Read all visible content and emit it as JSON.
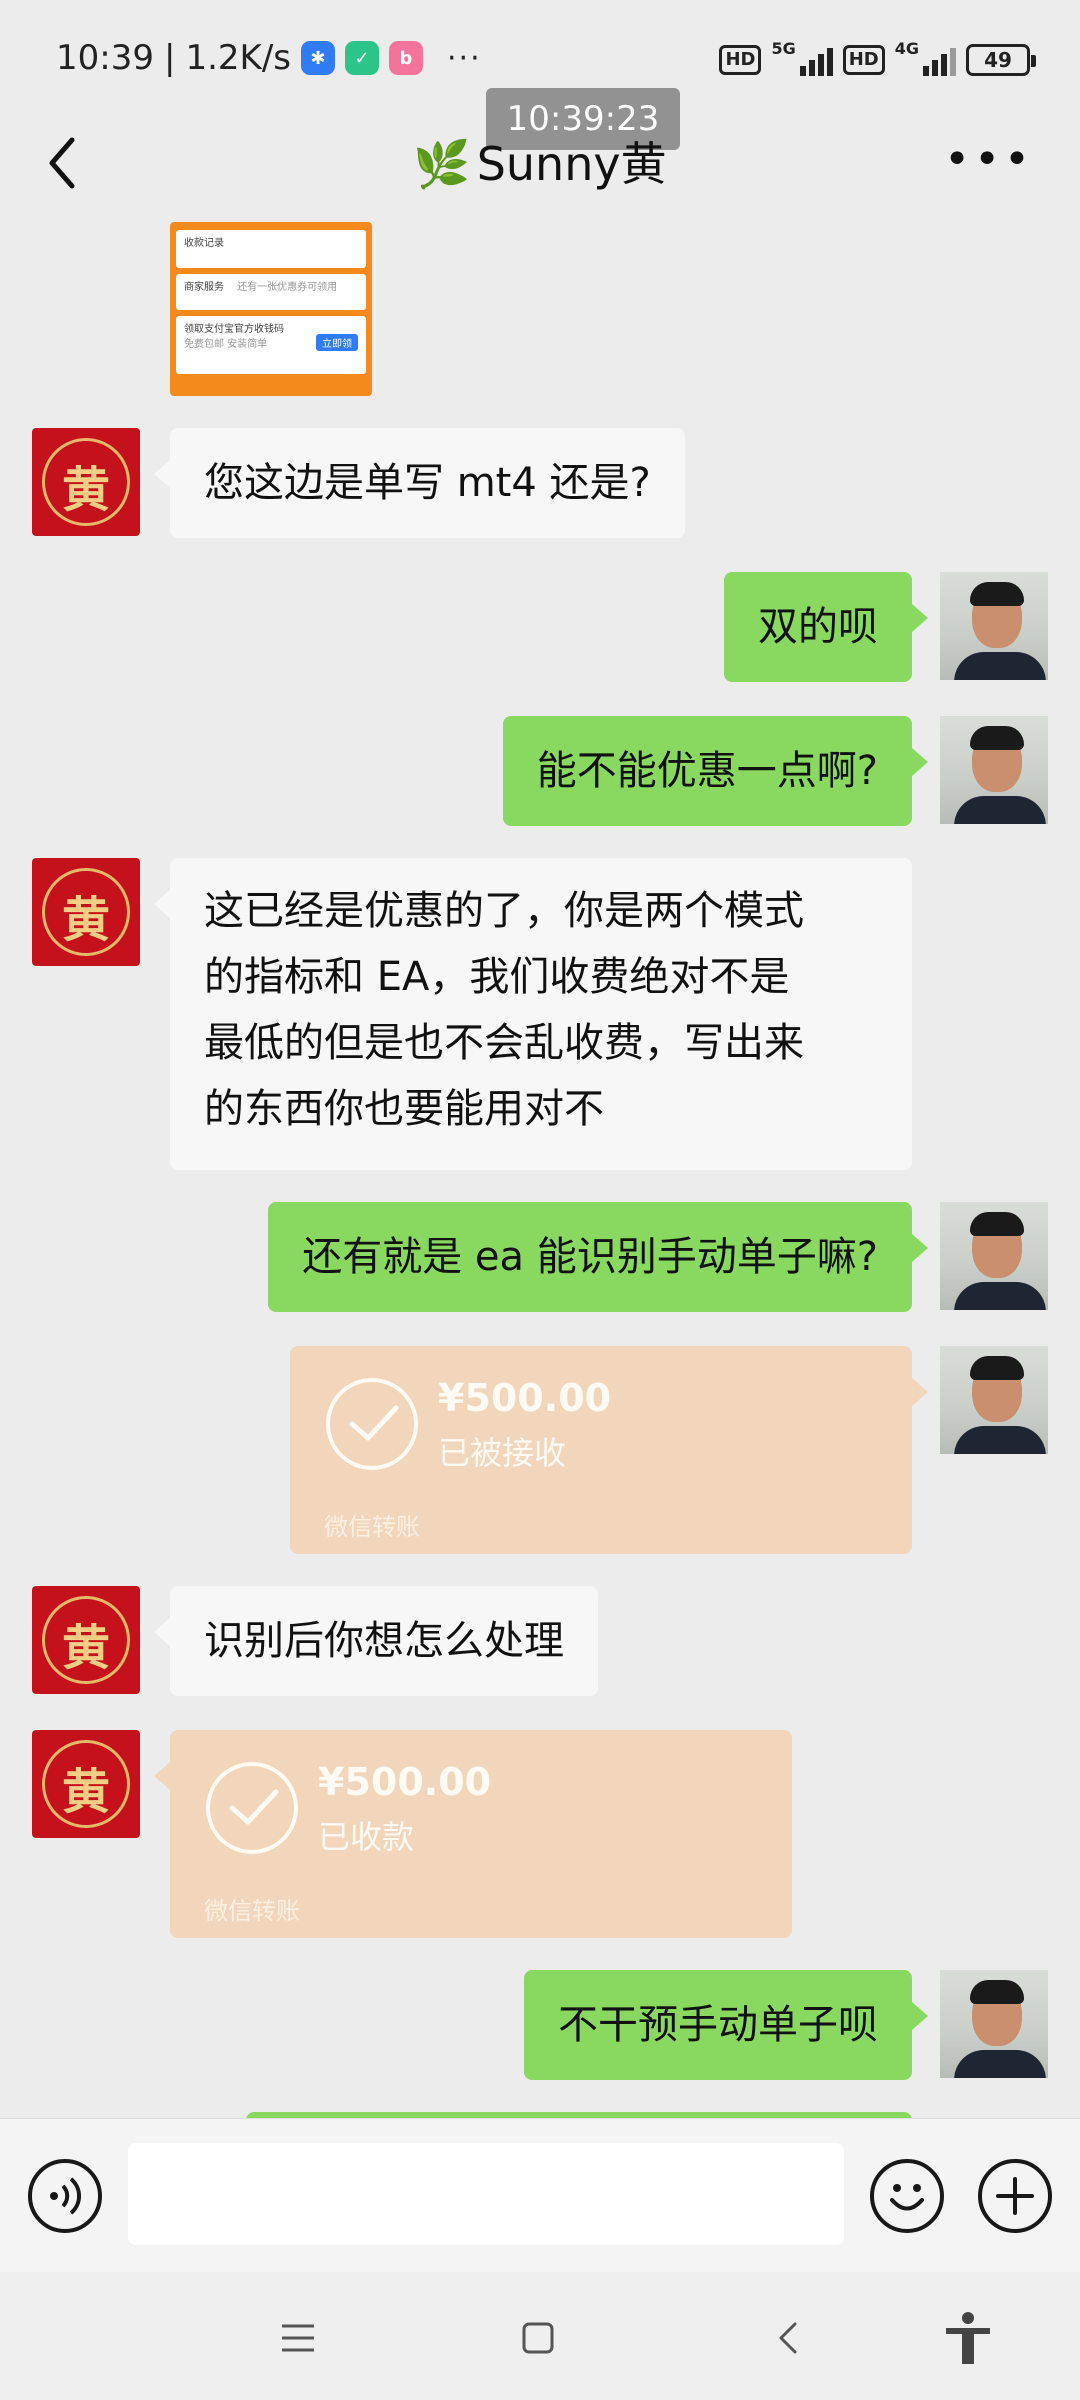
{
  "status_bar": {
    "time": "10:39",
    "speed": "1.2K/s",
    "dots": "···",
    "sim1_badge": "HD",
    "sim1_network": "5G",
    "sim2_badge": "HD",
    "sim2_network": "4G",
    "battery": "49"
  },
  "timestamp_overlay": "10:39:23",
  "header": {
    "title": "Sunny黄",
    "title_emoji": "🌿",
    "back_icon": "chevron-left-icon",
    "more_icon": "more-horizontal-icon"
  },
  "screenshot_card": {
    "row1": "收款记录",
    "row2": "商家服务",
    "row2_note": "还有一张优惠券可领用",
    "row3": "领取支付宝官方收钱码",
    "row3_sub": "免费包邮 安装简单",
    "row3_button": "立即领"
  },
  "messages": [
    {
      "side": "in",
      "text": "您这边是单写 mt4 还是?"
    },
    {
      "side": "out",
      "text": "双的呗"
    },
    {
      "side": "out",
      "text": "能不能优惠一点啊?"
    },
    {
      "side": "in",
      "lines": [
        "这已经是优惠的了，你是两个模式",
        "的指标和 EA，我们收费绝对不是",
        "最低的但是也不会乱收费，写出来",
        "的东西你也要能用对不"
      ]
    },
    {
      "side": "out",
      "text": "还有就是 ea 能识别手动单子嘛?"
    },
    {
      "side": "out",
      "type": "transfer",
      "amount": "¥500.00",
      "status": "已被接收",
      "label": "微信转账"
    },
    {
      "side": "in",
      "text": "识别后你想怎么处理"
    },
    {
      "side": "in",
      "type": "transfer",
      "amount": "¥500.00",
      "status": "已收款",
      "label": "微信转账"
    },
    {
      "side": "out",
      "text": "不干预手动单子呗"
    }
  ],
  "input_bar": {
    "voice_icon": "voice-icon",
    "emoji_icon": "emoji-icon",
    "plus_icon": "plus-icon"
  },
  "nav_bar": {
    "icons": [
      "menu-icon",
      "home-square-icon",
      "back-triangle-icon",
      "accessibility-icon"
    ]
  },
  "colors": {
    "chat_background": "#ececec",
    "outgoing_bubble": "#89d961",
    "incoming_bubble": "#f7f7f7",
    "transfer_card": "#f1d6bb",
    "avatar_red": "#c4111b"
  }
}
